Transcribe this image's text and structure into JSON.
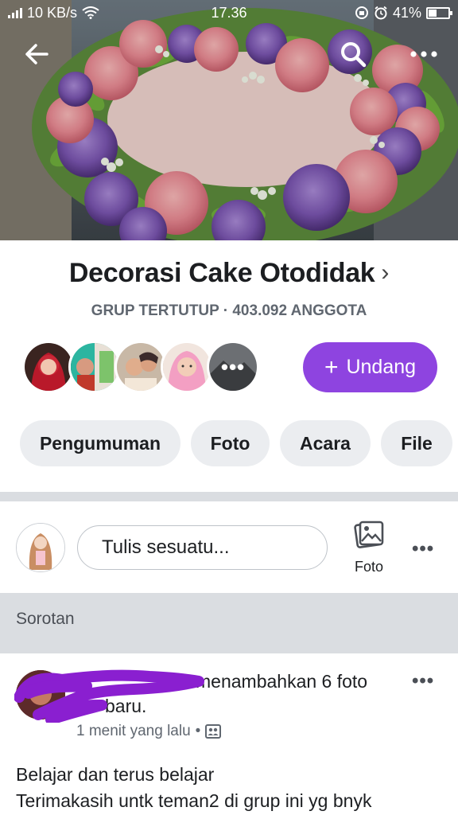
{
  "status_bar": {
    "network_speed": "10 KB/s",
    "time": "17.36",
    "battery": "41%",
    "battery_level": 0.41,
    "icons": [
      "signal-icon",
      "wifi-icon",
      "data-saver-icon",
      "alarm-icon",
      "battery-icon"
    ]
  },
  "top_bar": {
    "icons": [
      "back-arrow-icon",
      "search-icon",
      "more-icon"
    ]
  },
  "group": {
    "name": "Decorasi Cake Otodidak",
    "chevron": "›",
    "meta": "GRUP TERTUTUP · 403.092 ANGGOTA"
  },
  "members": {
    "more_label": "•••",
    "invite_plus": "+",
    "invite_label": "Undang"
  },
  "tabs": [
    {
      "label": "Pengumuman"
    },
    {
      "label": "Foto"
    },
    {
      "label": "Acara"
    },
    {
      "label": "File"
    }
  ],
  "composer": {
    "placeholder": "Tulis sesuatu...",
    "photo_label": "Foto",
    "more": "•••"
  },
  "highlights": {
    "title": "Sorotan"
  },
  "post": {
    "author_hidden": "",
    "action": "menambahkan 6 foto",
    "action_line2": "baru.",
    "time": "1 menit yang lalu",
    "separator": "•",
    "more": "•••",
    "body_line1": "Belajar dan terus belajar",
    "body_line2": "Terimakasih untk teman2 di grup ini yg bnyk"
  },
  "colors": {
    "accent": "#8e44e0",
    "chip_bg": "#ebedf0",
    "divider": "#dadde1",
    "scribble": "#8a1fd0"
  }
}
